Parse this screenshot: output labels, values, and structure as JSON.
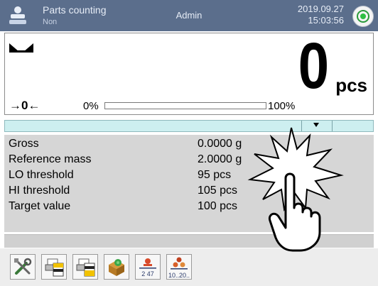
{
  "header": {
    "mode_title": "Parts counting",
    "mode_subtitle": "Non",
    "user": "Admin",
    "date": "2019.09.27",
    "time": "15:03:56",
    "app_icon": "parts-counting-icon",
    "status_icon": "stability-indicator-icon",
    "status_color": "#2fbf43"
  },
  "weighing": {
    "value": "0",
    "unit": "pcs",
    "zero_mark": "→0←",
    "scale_min": "0%",
    "scale_max": "100%",
    "bar_level": 0
  },
  "info": [
    {
      "label": "Gross",
      "value": "0.0000 g"
    },
    {
      "label": "Reference mass",
      "value": "2.0000 g"
    },
    {
      "label": "LO threshold",
      "value": "95 pcs"
    },
    {
      "label": "HI threshold",
      "value": "105 pcs"
    },
    {
      "label": "Target value",
      "value": "100 pcs"
    }
  ],
  "toolbar": {
    "buttons": [
      {
        "icon": "settings-tools-icon"
      },
      {
        "icon": "print-header-icon"
      },
      {
        "icon": "print-footer-icon"
      },
      {
        "icon": "database-box-icon"
      },
      {
        "icon": "piece-count-icon",
        "text": "2 47"
      },
      {
        "icon": "reference-sample-icon",
        "text": "10..20.."
      }
    ]
  },
  "overlay": {
    "icon": "tap-hand-icon"
  }
}
